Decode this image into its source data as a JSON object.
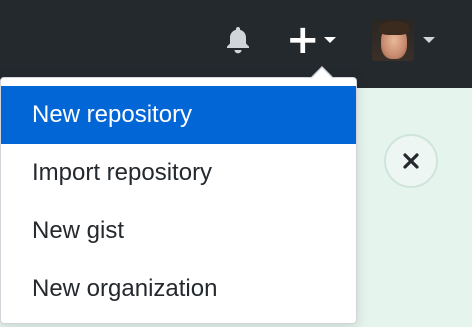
{
  "header": {
    "bell_icon": "bell-icon",
    "create_icon": "plus-icon",
    "create_caret_icon": "caret-down-icon",
    "avatar_icon": "avatar-image",
    "avatar_caret_icon": "caret-down-icon",
    "background_color": "#24292e"
  },
  "create_menu": {
    "items": [
      {
        "label": "New repository",
        "active": true
      },
      {
        "label": "Import repository",
        "active": false
      },
      {
        "label": "New gist",
        "active": false
      },
      {
        "label": "New organization",
        "active": false
      }
    ],
    "active_color": "#0366d6"
  },
  "notice": {
    "close_icon": "close-icon",
    "background_color": "#e6f4ee"
  }
}
